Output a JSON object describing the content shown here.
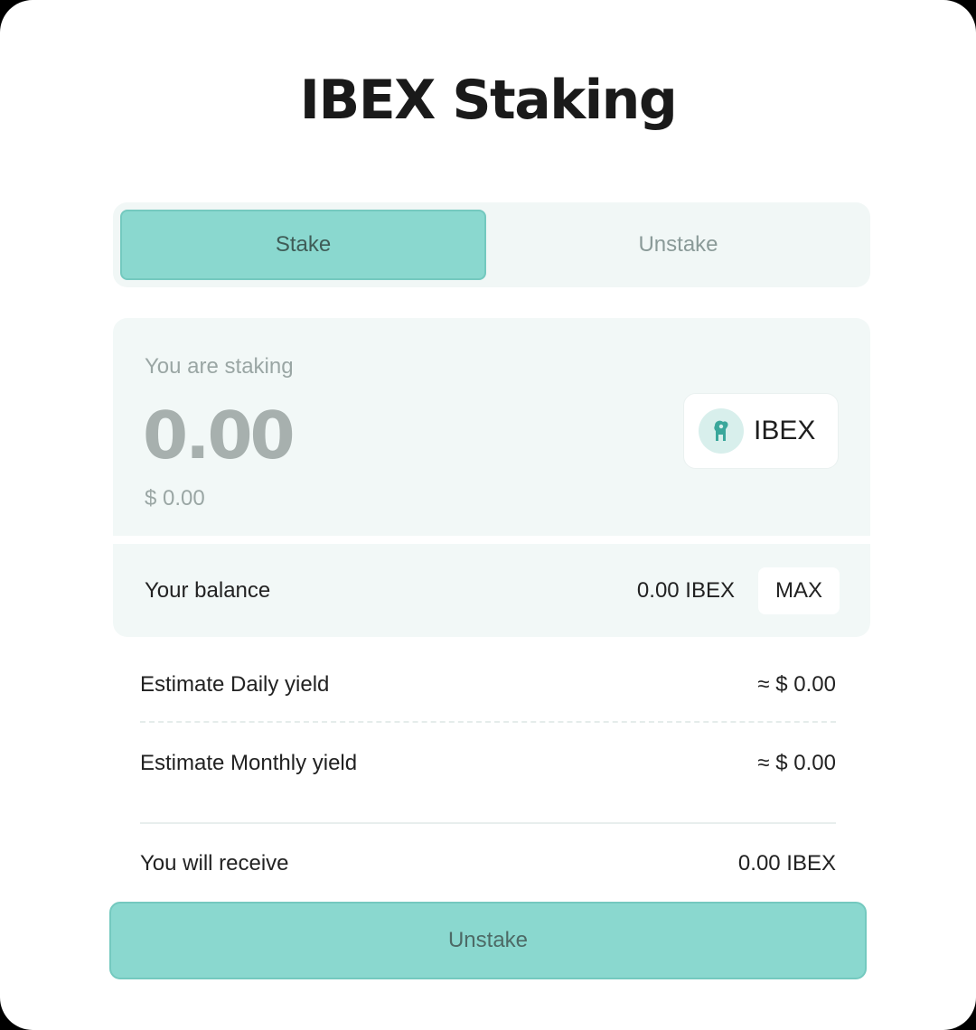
{
  "title": "IBEX Staking",
  "tabs": [
    {
      "label": "Stake",
      "active": true
    },
    {
      "label": "Unstake",
      "active": false
    }
  ],
  "stake": {
    "label": "You are staking",
    "amount": "0.00",
    "usd_value": "$ 0.00",
    "token": {
      "name": "IBEX",
      "icon": "ibex-goat-icon"
    }
  },
  "balance": {
    "label": "Your balance",
    "value": "0.00 IBEX",
    "max_label": "MAX"
  },
  "yields": {
    "daily_label": "Estimate Daily yield",
    "daily_value": "≈ $ 0.00",
    "monthly_label": "Estimate Monthly yield",
    "monthly_value": "≈ $ 0.00"
  },
  "receive": {
    "label": "You will receive",
    "value": "0.00 IBEX"
  },
  "submit_label": "Unstake",
  "colors": {
    "accent": "#8ad8cf",
    "panel": "#f2f8f7",
    "logo": "#3aa79b"
  }
}
